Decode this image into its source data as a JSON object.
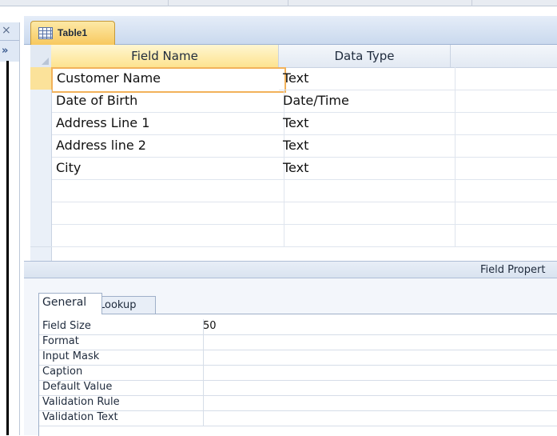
{
  "document_tab": {
    "label": "Table1",
    "icon": "table-icon"
  },
  "grid": {
    "headers": {
      "field_name": "Field Name",
      "data_type": "Data Type",
      "description": ""
    },
    "rows": [
      {
        "field_name": "Customer Name",
        "data_type": "Text",
        "description": ""
      },
      {
        "field_name": "Date of Birth",
        "data_type": "Date/Time",
        "description": ""
      },
      {
        "field_name": "Address Line 1",
        "data_type": "Text",
        "description": ""
      },
      {
        "field_name": "Address line 2",
        "data_type": "Text",
        "description": ""
      },
      {
        "field_name": "City",
        "data_type": "Text",
        "description": ""
      },
      {
        "field_name": "",
        "data_type": "",
        "description": ""
      },
      {
        "field_name": "",
        "data_type": "",
        "description": ""
      },
      {
        "field_name": "",
        "data_type": "",
        "description": ""
      }
    ]
  },
  "field_properties": {
    "title": "Field Propert",
    "tabs": {
      "general": "General",
      "lookup": "Lookup"
    },
    "rows": [
      {
        "label": "Field Size",
        "value": "50"
      },
      {
        "label": "Format",
        "value": ""
      },
      {
        "label": "Input Mask",
        "value": ""
      },
      {
        "label": "Caption",
        "value": ""
      },
      {
        "label": "Default Value",
        "value": ""
      },
      {
        "label": "Validation Rule",
        "value": ""
      },
      {
        "label": "Validation Text",
        "value": ""
      }
    ]
  },
  "colors": {
    "active_tab": "#f7c65a",
    "header_highlight": "#fde38f",
    "selection_border": "#f2b25a",
    "chrome_blue": "#cad9ee"
  }
}
